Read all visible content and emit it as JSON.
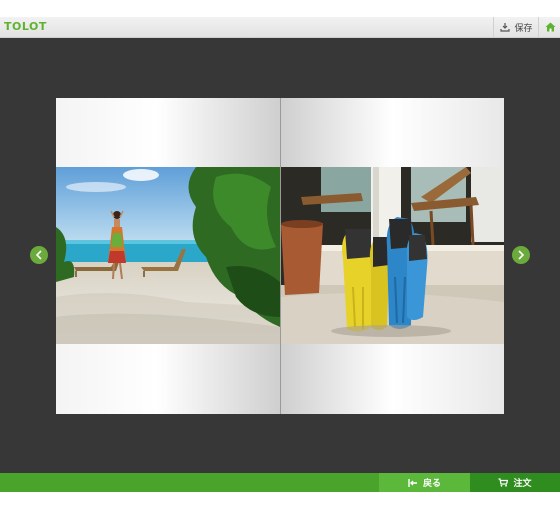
{
  "header": {
    "logo_text": "TOLOT",
    "save_label": "保存"
  },
  "footer": {
    "back_label": "戻る",
    "order_label": "注文"
  },
  "colors": {
    "brand_green": "#5fb22f",
    "stage_bg": "#373737",
    "order_green": "#2f8c1e"
  },
  "icons": {
    "save": "download-icon",
    "home": "home-icon",
    "prev": "chevron-left-icon",
    "next": "chevron-right-icon",
    "back": "back-arrow-icon",
    "cart": "cart-icon"
  }
}
